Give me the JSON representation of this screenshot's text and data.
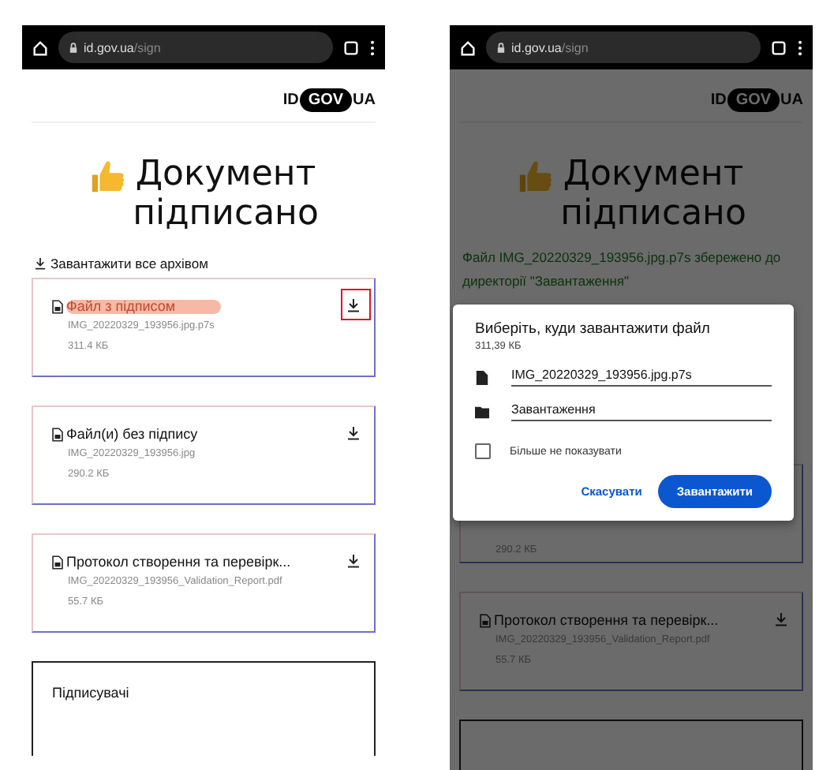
{
  "screens": [
    {
      "dimmed": false,
      "browser": {
        "host": "id.gov.ua",
        "path": "/sign"
      },
      "logo": {
        "left": "ID",
        "middle": "GOV",
        "right": "UA"
      },
      "title": [
        "Документ",
        "підписано"
      ],
      "download_all": "Завантажити все архівом",
      "files": [
        {
          "title": "Файл з підписом",
          "filename": "IMG_20220329_193956.jpg.p7s",
          "size": "311.4 КБ",
          "highlighted": true,
          "boxed": true
        },
        {
          "title": "Файл(и) без підпису",
          "filename": "IMG_20220329_193956.jpg",
          "size": "290.2 КБ",
          "highlighted": false,
          "boxed": false
        },
        {
          "title": "Протокол створення та перевірк...",
          "filename": "IMG_20220329_193956_Validation_Report.pdf",
          "size": "55.7 КБ",
          "highlighted": false,
          "boxed": false
        }
      ],
      "signers_title": "Підписувачі"
    },
    {
      "dimmed": true,
      "browser": {
        "host": "id.gov.ua",
        "path": "/sign"
      },
      "logo": {
        "left": "ID",
        "middle": "GOV",
        "right": "UA"
      },
      "title": [
        "Документ",
        "підписано"
      ],
      "notice": "Файл IMG_20220329_193956.jpg.p7s збережено до директорії \"Завантаження\"",
      "files": [
        {
          "size": "290.2 КБ"
        },
        {
          "title": "Протокол створення та перевірк...",
          "filename": "IMG_20220329_193956_Validation_Report.pdf",
          "size": "55.7 КБ",
          "highlighted": false,
          "boxed": false
        }
      ],
      "dialog": {
        "title": "Виберіть, куди завантажити файл",
        "size": "311,39 КБ",
        "filename": "IMG_20220329_193956.jpg.p7s",
        "folder": "Завантаження",
        "checkbox": {
          "label": "Більше не показувати",
          "checked": false
        },
        "cancel": "Скасувати",
        "confirm": "Завантажити"
      }
    }
  ]
}
